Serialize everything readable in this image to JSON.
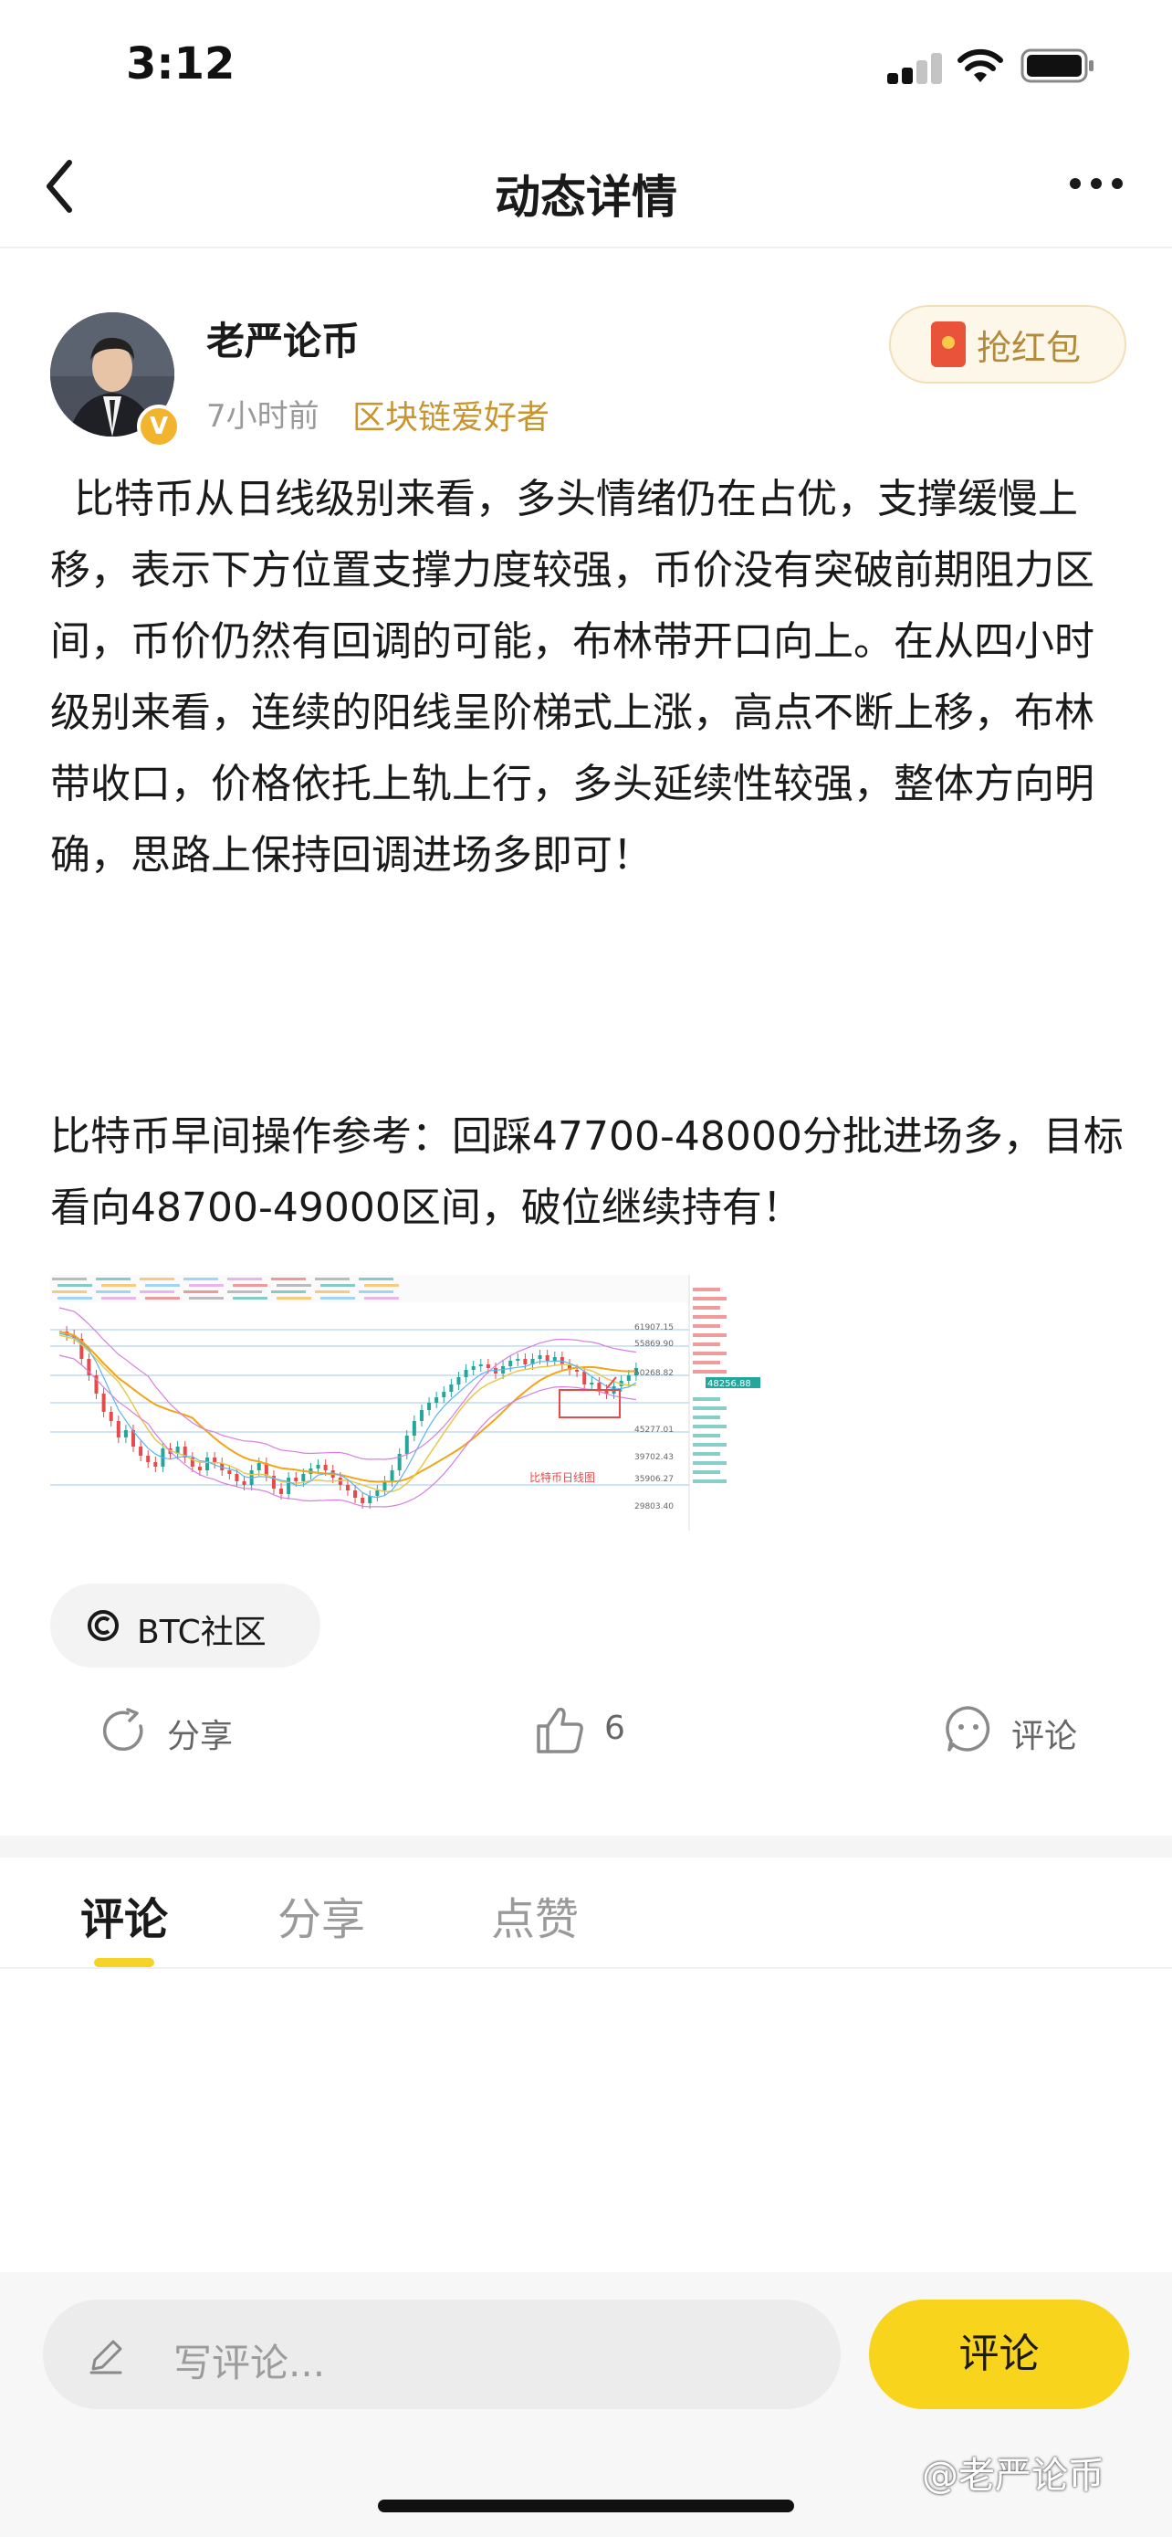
{
  "status_bar": {
    "time": "3:12"
  },
  "nav": {
    "title": "动态详情"
  },
  "post": {
    "author_name": "老严论币",
    "time_ago": "7小时前",
    "author_tag": "区块链爱好者",
    "verified_mark": "V",
    "red_packet_label": "抢红包",
    "paragraphs": [
      "比特币从日线级别来看，多头情绪仍在占优，支撑缓慢上移，表示下方位置支撑力度较强，币价没有突破前期阻力区间，币价仍然有回调的可能，布林带开口向上。在从四小时级别来看，连续的阳线呈阶梯式上涨，高点不断上移，布林带收口，价格依托上轨上行，多头延续性较强，整体方向明确，思路上保持回调进场多即可！",
      "比特币早间操作参考：回踩47700-48000分批进场多，目标看向48700-49000区间，破位继续持有！"
    ],
    "topic": "BTC社区"
  },
  "chart_image": {
    "annotation": "比特币日线图",
    "price_labels": [
      "61907.15",
      "55869.90",
      "50268.82",
      "48256.88",
      "45277.01",
      "39702.43",
      "35906.27",
      "29803.40"
    ],
    "current_price": "48256.88",
    "colors": {
      "up": "#26a69a",
      "down": "#e64a4a",
      "ma_orange": "#f3a417",
      "ma_yellow": "#e8c84a",
      "ma_blue": "#5bb3f0",
      "boll_pink": "#d77ee0",
      "fib_line": "#9ec9ee"
    }
  },
  "actions": {
    "share_label": "分享",
    "like_count": "6",
    "comment_label": "评论"
  },
  "tabs": [
    "评论",
    "分享",
    "点赞"
  ],
  "active_tab": "评论",
  "comment_bar": {
    "placeholder": "写评论...",
    "submit_label": "评论"
  },
  "watermark": "@老严论币",
  "colors": {
    "accent_yellow": "#f8d51c",
    "tag_gold": "#c8962e",
    "red_packet": "#e9533a"
  }
}
